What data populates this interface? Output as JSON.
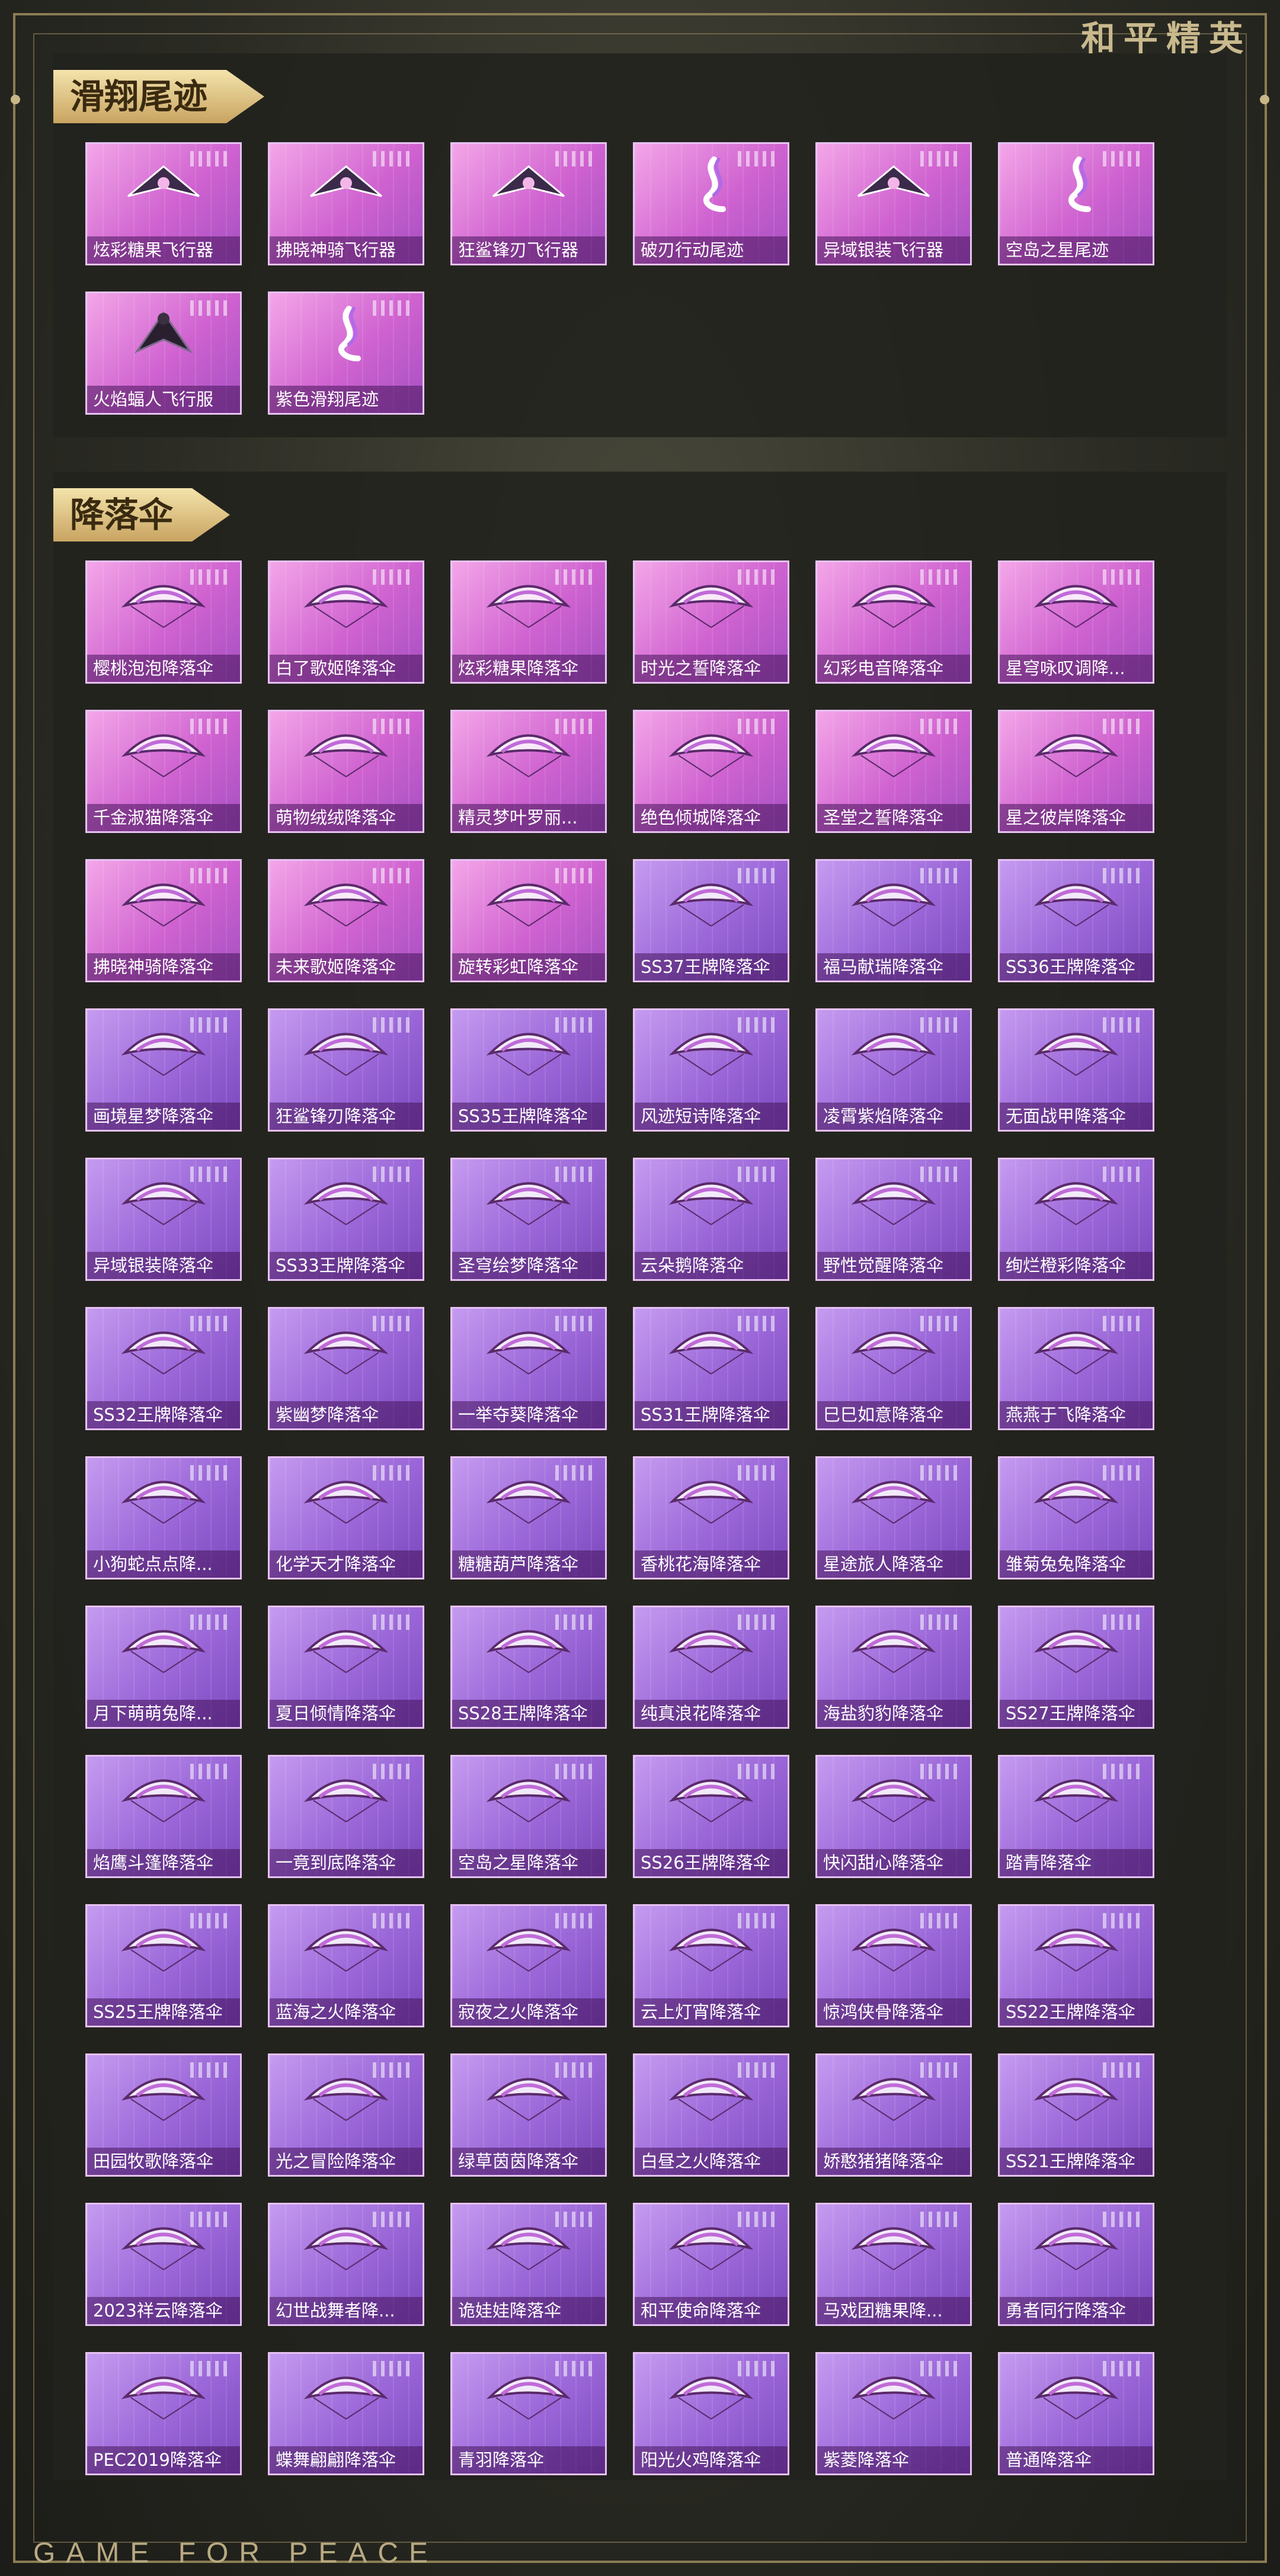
{
  "brand": "和平精英",
  "footer": "GAME FOR PEACE",
  "sections": [
    {
      "title": "滑翔尾迹",
      "items": [
        {
          "name": "炫彩糖果飞行器",
          "art": "glider-icon",
          "tier": "pink"
        },
        {
          "name": "拂晓神骑飞行器",
          "art": "glider-icon",
          "tier": "pink"
        },
        {
          "name": "狂鲨锋刃飞行器",
          "art": "glider-icon",
          "tier": "pink"
        },
        {
          "name": "破刃行动尾迹",
          "art": "trail-icon",
          "tier": "pink"
        },
        {
          "name": "异域银装飞行器",
          "art": "glider-icon",
          "tier": "pink"
        },
        {
          "name": "空岛之星尾迹",
          "art": "trail-icon",
          "tier": "pink"
        },
        {
          "name": "火焰蝠人飞行服",
          "art": "wingsuit-icon",
          "tier": "pink"
        },
        {
          "name": "紫色滑翔尾迹",
          "art": "trail-icon",
          "tier": "pink"
        }
      ]
    },
    {
      "title": "降落伞",
      "items": [
        {
          "name": "樱桃泡泡降落伞",
          "art": "parachute-icon",
          "tier": "pink"
        },
        {
          "name": "白了歌姬降落伞",
          "art": "parachute-icon",
          "tier": "pink"
        },
        {
          "name": "炫彩糖果降落伞",
          "art": "parachute-icon",
          "tier": "pink"
        },
        {
          "name": "时光之誓降落伞",
          "art": "parachute-icon",
          "tier": "pink"
        },
        {
          "name": "幻彩电音降落伞",
          "art": "parachute-icon",
          "tier": "pink"
        },
        {
          "name": "星穹咏叹调降...",
          "art": "parachute-icon",
          "tier": "pink"
        },
        {
          "name": "千金淑猫降落伞",
          "art": "parachute-icon",
          "tier": "pink"
        },
        {
          "name": "萌物绒绒降落伞",
          "art": "parachute-icon",
          "tier": "pink"
        },
        {
          "name": "精灵梦叶罗丽...",
          "art": "parachute-icon",
          "tier": "pink"
        },
        {
          "name": "绝色倾城降落伞",
          "art": "parachute-icon",
          "tier": "pink"
        },
        {
          "name": "圣堂之誓降落伞",
          "art": "parachute-icon",
          "tier": "pink"
        },
        {
          "name": "星之彼岸降落伞",
          "art": "parachute-icon",
          "tier": "pink"
        },
        {
          "name": "拂晓神骑降落伞",
          "art": "parachute-icon",
          "tier": "pink"
        },
        {
          "name": "未来歌姬降落伞",
          "art": "parachute-icon",
          "tier": "pink"
        },
        {
          "name": "旋转彩虹降落伞",
          "art": "parachute-icon",
          "tier": "pink"
        },
        {
          "name": "SS37王牌降落伞",
          "art": "parachute-icon",
          "tier": "purple"
        },
        {
          "name": "福马献瑞降落伞",
          "art": "parachute-icon",
          "tier": "purple"
        },
        {
          "name": "SS36王牌降落伞",
          "art": "parachute-icon",
          "tier": "purple"
        },
        {
          "name": "画境星梦降落伞",
          "art": "parachute-icon",
          "tier": "purple"
        },
        {
          "name": "狂鲨锋刃降落伞",
          "art": "parachute-icon",
          "tier": "purple"
        },
        {
          "name": "SS35王牌降落伞",
          "art": "parachute-icon",
          "tier": "purple"
        },
        {
          "name": "风迹短诗降落伞",
          "art": "parachute-icon",
          "tier": "purple"
        },
        {
          "name": "凌霄紫焰降落伞",
          "art": "parachute-icon",
          "tier": "purple"
        },
        {
          "name": "无面战甲降落伞",
          "art": "parachute-icon",
          "tier": "purple"
        },
        {
          "name": "异域银装降落伞",
          "art": "parachute-icon",
          "tier": "purple"
        },
        {
          "name": "SS33王牌降落伞",
          "art": "parachute-icon",
          "tier": "purple"
        },
        {
          "name": "圣穹绘梦降落伞",
          "art": "parachute-icon",
          "tier": "purple"
        },
        {
          "name": "云朵鹅降落伞",
          "art": "parachute-icon",
          "tier": "purple"
        },
        {
          "name": "野性觉醒降落伞",
          "art": "parachute-icon",
          "tier": "purple"
        },
        {
          "name": "绚烂橙彩降落伞",
          "art": "parachute-icon",
          "tier": "purple"
        },
        {
          "name": "SS32王牌降落伞",
          "art": "parachute-icon",
          "tier": "purple"
        },
        {
          "name": "紫幽梦降落伞",
          "art": "parachute-icon",
          "tier": "purple"
        },
        {
          "name": "一举夺葵降落伞",
          "art": "parachute-icon",
          "tier": "purple"
        },
        {
          "name": "SS31王牌降落伞",
          "art": "parachute-icon",
          "tier": "purple"
        },
        {
          "name": "巳巳如意降落伞",
          "art": "parachute-icon",
          "tier": "purple"
        },
        {
          "name": "燕燕于飞降落伞",
          "art": "parachute-icon",
          "tier": "purple"
        },
        {
          "name": "小狗蛇点点降...",
          "art": "parachute-icon",
          "tier": "purple"
        },
        {
          "name": "化学天才降落伞",
          "art": "parachute-icon",
          "tier": "purple"
        },
        {
          "name": "糖糖葫芦降落伞",
          "art": "parachute-icon",
          "tier": "purple"
        },
        {
          "name": "香桃花海降落伞",
          "art": "parachute-icon",
          "tier": "purple"
        },
        {
          "name": "星途旅人降落伞",
          "art": "parachute-icon",
          "tier": "purple"
        },
        {
          "name": "雏菊兔兔降落伞",
          "art": "parachute-icon",
          "tier": "purple"
        },
        {
          "name": "月下萌萌兔降...",
          "art": "parachute-icon",
          "tier": "purple"
        },
        {
          "name": "夏日倾情降落伞",
          "art": "parachute-icon",
          "tier": "purple"
        },
        {
          "name": "SS28王牌降落伞",
          "art": "parachute-icon",
          "tier": "purple"
        },
        {
          "name": "纯真浪花降落伞",
          "art": "parachute-icon",
          "tier": "purple"
        },
        {
          "name": "海盐豹豹降落伞",
          "art": "parachute-icon",
          "tier": "purple"
        },
        {
          "name": "SS27王牌降落伞",
          "art": "parachute-icon",
          "tier": "purple"
        },
        {
          "name": "焰鹰斗篷降落伞",
          "art": "parachute-icon",
          "tier": "purple"
        },
        {
          "name": "一竟到底降落伞",
          "art": "parachute-icon",
          "tier": "purple"
        },
        {
          "name": "空岛之星降落伞",
          "art": "parachute-icon",
          "tier": "purple"
        },
        {
          "name": "SS26王牌降落伞",
          "art": "parachute-icon",
          "tier": "purple"
        },
        {
          "name": "快闪甜心降落伞",
          "art": "parachute-icon",
          "tier": "purple"
        },
        {
          "name": "踏青降落伞",
          "art": "parachute-icon",
          "tier": "purple"
        },
        {
          "name": "SS25王牌降落伞",
          "art": "parachute-icon",
          "tier": "purple"
        },
        {
          "name": "蓝海之火降落伞",
          "art": "parachute-icon",
          "tier": "purple"
        },
        {
          "name": "寂夜之火降落伞",
          "art": "parachute-icon",
          "tier": "purple"
        },
        {
          "name": "云上灯宵降落伞",
          "art": "parachute-icon",
          "tier": "purple"
        },
        {
          "name": "惊鸿侠骨降落伞",
          "art": "parachute-icon",
          "tier": "purple"
        },
        {
          "name": "SS22王牌降落伞",
          "art": "parachute-icon",
          "tier": "purple"
        },
        {
          "name": "田园牧歌降落伞",
          "art": "parachute-icon",
          "tier": "purple"
        },
        {
          "name": "光之冒险降落伞",
          "art": "parachute-icon",
          "tier": "purple"
        },
        {
          "name": "绿草茵茵降落伞",
          "art": "parachute-icon",
          "tier": "purple"
        },
        {
          "name": "白昼之火降落伞",
          "art": "parachute-icon",
          "tier": "purple"
        },
        {
          "name": "娇憨猪猪降落伞",
          "art": "parachute-icon",
          "tier": "purple"
        },
        {
          "name": "SS21王牌降落伞",
          "art": "parachute-icon",
          "tier": "purple"
        },
        {
          "name": "2023祥云降落伞",
          "art": "parachute-icon",
          "tier": "purple"
        },
        {
          "name": "幻世战舞者降...",
          "art": "parachute-icon",
          "tier": "purple"
        },
        {
          "name": "诡娃娃降落伞",
          "art": "parachute-icon",
          "tier": "purple"
        },
        {
          "name": "和平使命降落伞",
          "art": "parachute-icon",
          "tier": "purple"
        },
        {
          "name": "马戏团糖果降...",
          "art": "parachute-icon",
          "tier": "purple"
        },
        {
          "name": "勇者同行降落伞",
          "art": "parachute-icon",
          "tier": "purple"
        },
        {
          "name": "PEC2019降落伞",
          "art": "parachute-icon",
          "tier": "purple"
        },
        {
          "name": "蝶舞翩翩降落伞",
          "art": "parachute-icon",
          "tier": "purple"
        },
        {
          "name": "青羽降落伞",
          "art": "parachute-icon",
          "tier": "purple"
        },
        {
          "name": "阳光火鸡降落伞",
          "art": "parachute-icon",
          "tier": "purple"
        },
        {
          "name": "紫菱降落伞",
          "art": "parachute-icon",
          "tier": "purple"
        },
        {
          "name": "普通降落伞",
          "art": "parachute-icon",
          "tier": "purple"
        }
      ]
    }
  ],
  "colors": {
    "pink_card": "#cf62d0",
    "purple_card": "#9a66d8",
    "title_gold": "#d9b977",
    "panel": "#22221e"
  }
}
